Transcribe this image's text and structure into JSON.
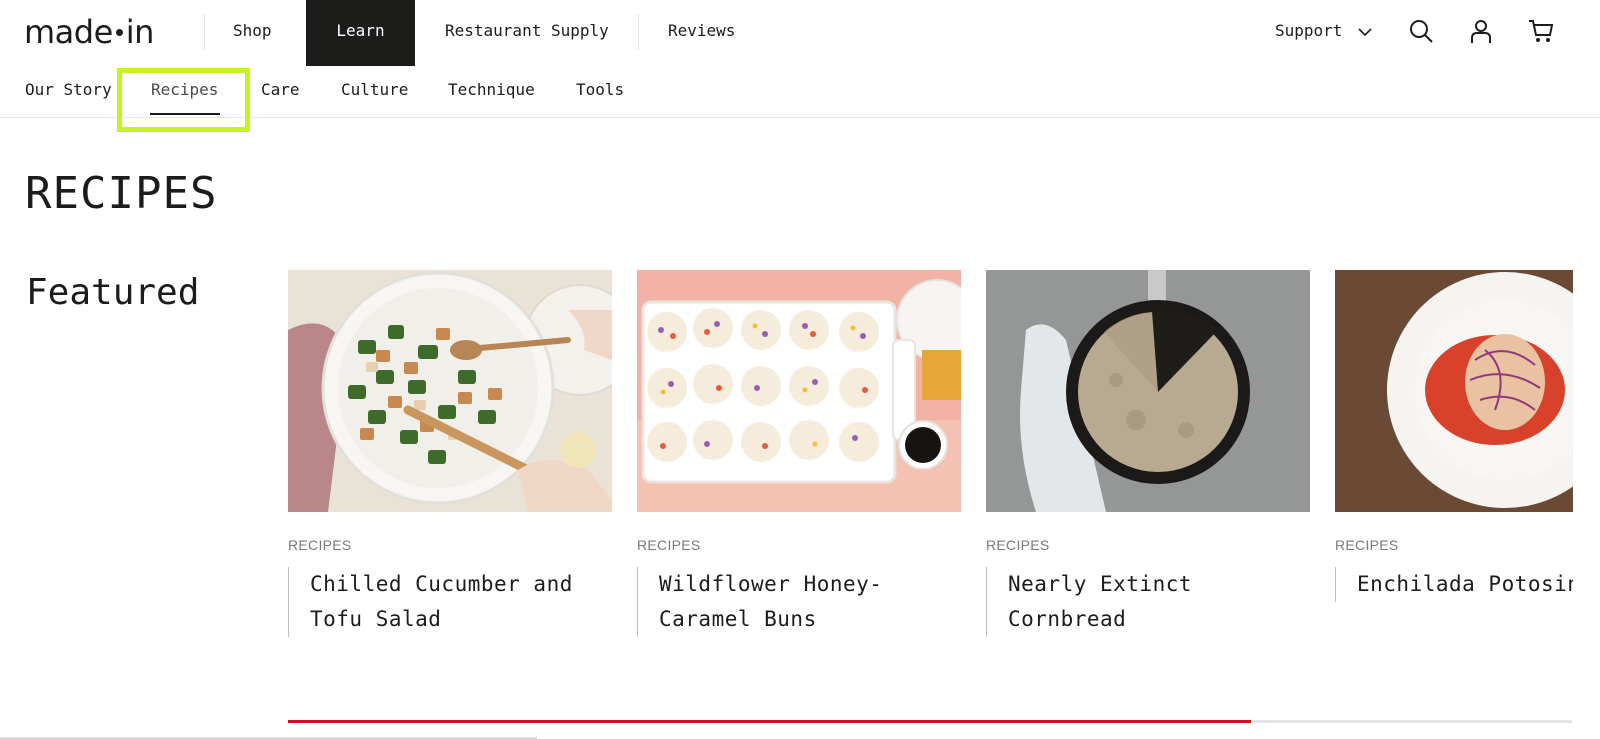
{
  "brand": {
    "logo_left": "made",
    "logo_right": "in"
  },
  "topnav": {
    "items": [
      {
        "label": "Shop"
      },
      {
        "label": "Learn",
        "active": true
      },
      {
        "label": "Restaurant Supply"
      },
      {
        "label": "Reviews"
      }
    ],
    "support_label": "Support",
    "icons": [
      "chevron-down-icon",
      "search-icon",
      "account-icon",
      "cart-icon"
    ]
  },
  "subnav": {
    "items": [
      {
        "label": "Our Story"
      },
      {
        "label": "Recipes",
        "current": true
      },
      {
        "label": "Care"
      },
      {
        "label": "Culture"
      },
      {
        "label": "Technique"
      },
      {
        "label": "Tools"
      }
    ]
  },
  "page": {
    "title": "RECIPES",
    "section_title": "Featured"
  },
  "cards": [
    {
      "category": "RECIPES",
      "title": "Chilled Cucumber and Tofu Salad"
    },
    {
      "category": "RECIPES",
      "title": "Wildflower Honey-Caramel Buns"
    },
    {
      "category": "RECIPES",
      "title": "Nearly Extinct Cornbread"
    },
    {
      "category": "RECIPES",
      "title": "Enchilada Potosina"
    }
  ],
  "carousel": {
    "progress_fraction": 0.75
  },
  "colors": {
    "accent_red": "#c4161c",
    "highlight": "#c6f31f",
    "nav_dark": "#1c1c1a"
  }
}
